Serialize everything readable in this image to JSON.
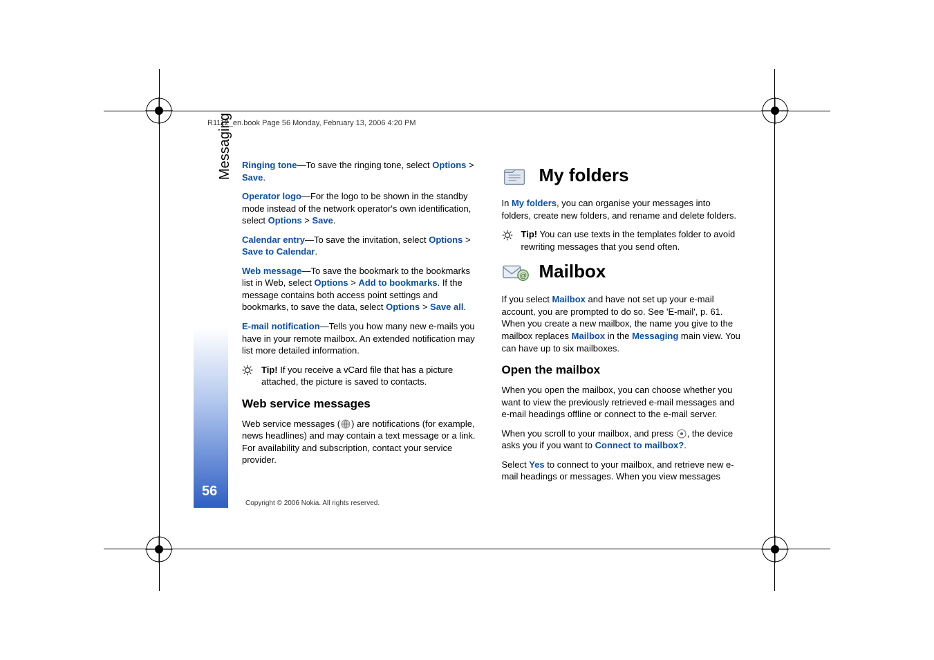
{
  "header": "R1112_en.book  Page 56  Monday, February 13, 2006  4:20 PM",
  "side_label": "Messaging",
  "page_number": "56",
  "footer": "Copyright © 2006 Nokia. All rights reserved.",
  "col1": {
    "ringing_tone_label": "Ringing tone",
    "ringing_tone_text": "—To save the ringing tone, select ",
    "options": "Options",
    "gt": " > ",
    "save": "Save",
    "period": ".",
    "operator_logo_label": "Operator logo",
    "operator_logo_text": "—For the logo to be shown in the standby mode instead of the network operator's own identification, select ",
    "calendar_entry_label": "Calendar entry",
    "calendar_entry_text": "—To save the invitation, select ",
    "save_to_calendar": "Save to Calendar",
    "web_message_label": "Web message",
    "web_message_text1": "—To save the bookmark to the bookmarks list in Web, select ",
    "add_to_bookmarks": "Add to bookmarks",
    "web_message_text2": ". If the message contains both access point settings and bookmarks, to save the data, select ",
    "save_all": "Save all",
    "email_notif_label": "E-mail notification",
    "email_notif_text": "—Tells you how many new e-mails you have in your remote mailbox. An extended notification may list more detailed information.",
    "tip_label": "Tip!",
    "tip_text": " If you receive a vCard file that has a picture attached, the picture is saved to contacts.",
    "web_svc_heading": "Web service messages",
    "web_svc_text1": "Web service messages (",
    "web_svc_text2": ") are notifications (for example, news headlines) and may contain a text message or a link. For availability and subscription, contact your service provider."
  },
  "col2": {
    "my_folders_heading": "My folders",
    "my_folders_text1": "In ",
    "my_folders_link": "My folders",
    "my_folders_text2": ", you can organise your messages into folders, create new folders, and rename and delete folders.",
    "tip_label": "Tip!",
    "tip_text": " You can use texts in the templates folder to avoid rewriting messages that you send often.",
    "mailbox_heading": "Mailbox",
    "mailbox_text1": "If you select ",
    "mailbox_link": "Mailbox",
    "mailbox_text2": " and have not set up your e-mail account, you are prompted to do so. See 'E-mail', p. 61. When you create a new mailbox, the name you give to the mailbox replaces ",
    "mailbox_text3": " in the ",
    "messaging_link": "Messaging",
    "mailbox_text4": " main view. You can have up to six mailboxes.",
    "open_mailbox_heading": "Open the mailbox",
    "open_text1": "When you open the mailbox, you can choose whether you want to view the previously retrieved e-mail messages and e-mail headings offline or connect to the e-mail server.",
    "open_text2a": "When you scroll to your mailbox, and press ",
    "open_text2b": ", the device asks you if you want to ",
    "connect_link": "Connect to mailbox?",
    "open_text3a": "Select ",
    "yes_link": "Yes",
    "open_text3b": " to connect to your mailbox, and retrieve new e-mail headings or messages. When you view messages"
  }
}
